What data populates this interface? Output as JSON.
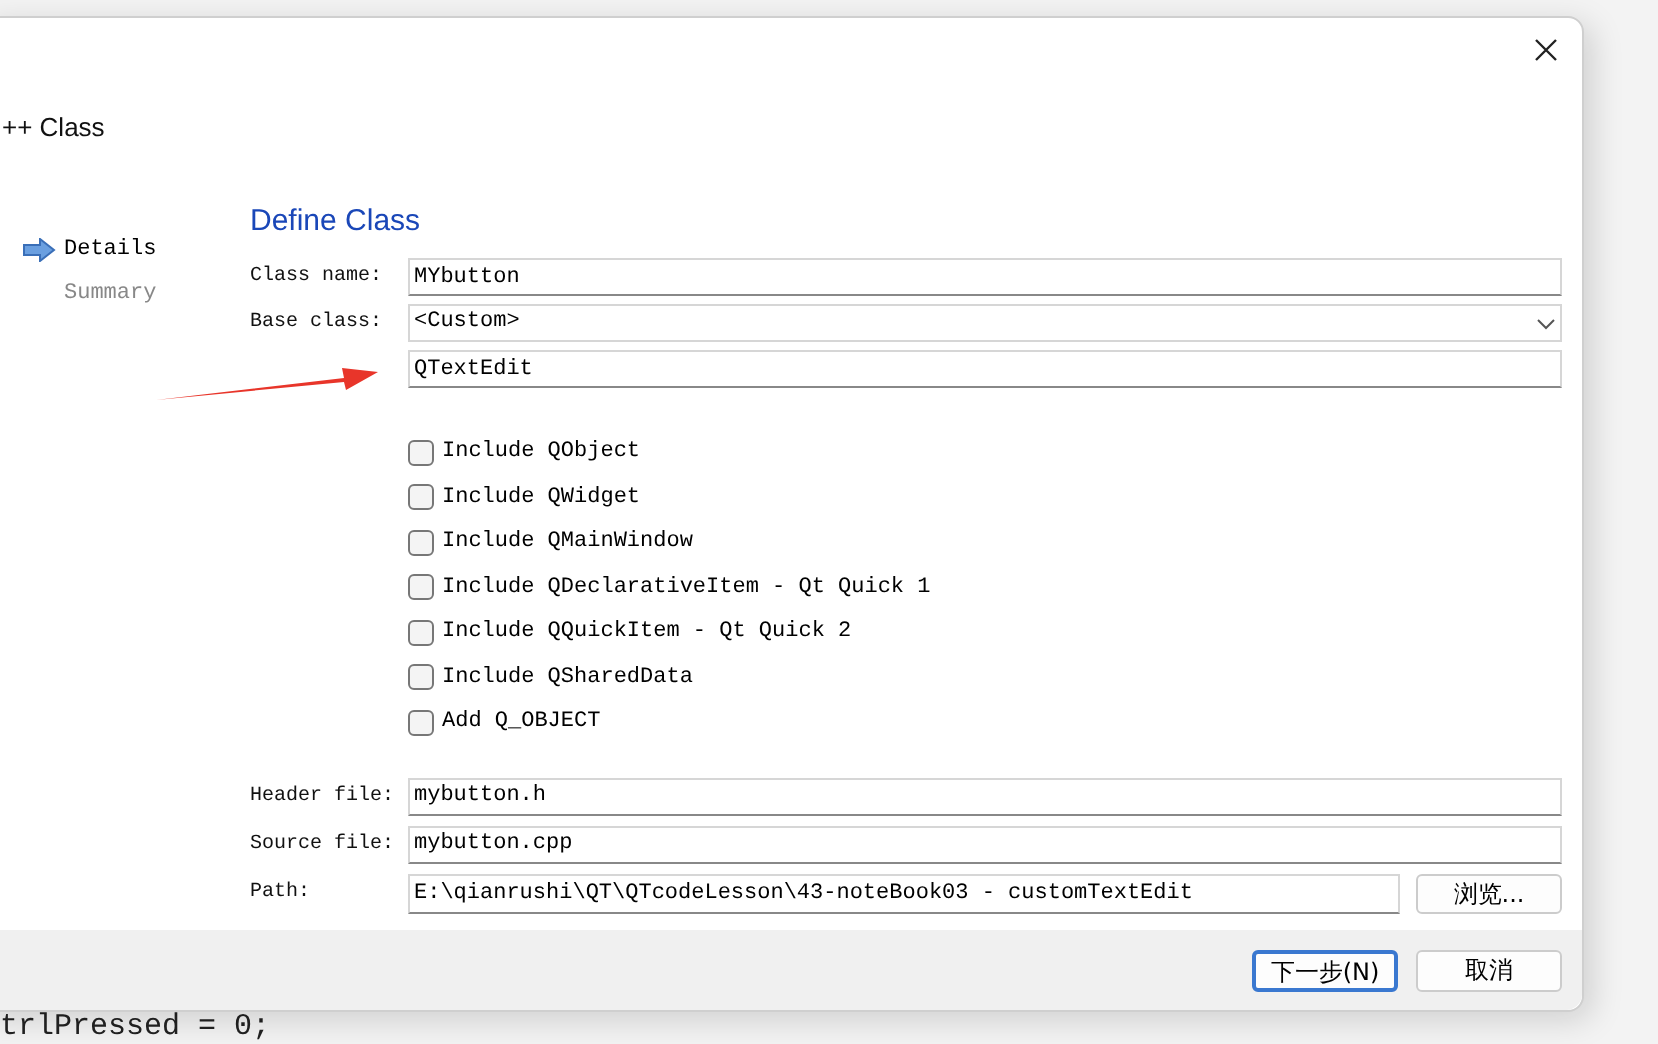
{
  "window": {
    "title": "++ Class"
  },
  "sidebar": {
    "items": [
      {
        "label": "Details",
        "selected": true
      },
      {
        "label": "Summary",
        "selected": false
      }
    ]
  },
  "page_title": "Define Class",
  "fields": [
    {
      "kind": "text",
      "label": "Class name:",
      "value": "MYbutton"
    },
    {
      "kind": "dropdown",
      "label": "Base class:",
      "value": "<Custom>"
    },
    {
      "kind": "text",
      "value": "QTextEdit"
    }
  ],
  "checkboxes": [
    {
      "label": "Include QObject",
      "checked": false
    },
    {
      "label": "Include QWidget",
      "checked": false
    },
    {
      "label": "Include QMainWindow",
      "checked": false
    },
    {
      "label": "Include QDeclarativeItem - Qt Quick 1",
      "checked": false
    },
    {
      "label": "Include QQuickItem - Qt Quick 2",
      "checked": false
    },
    {
      "label": "Include QSharedData",
      "checked": false
    },
    {
      "label": "Add Q_OBJECT",
      "checked": false
    }
  ],
  "files": [
    {
      "label": "Header file:",
      "value": "mybutton.h"
    },
    {
      "label": "Source file:",
      "value": "mybutton.cpp"
    }
  ],
  "path": {
    "label": "Path:",
    "value": "E:\\qianrushi\\QT\\QTcodeLesson\\43-noteBook03 - customTextEdit",
    "browse": "浏览..."
  },
  "buttons": [
    {
      "label": "下一步(N)",
      "default": true
    },
    {
      "label": "取消",
      "default": false
    }
  ],
  "background_code": "trlPressed = 0;"
}
